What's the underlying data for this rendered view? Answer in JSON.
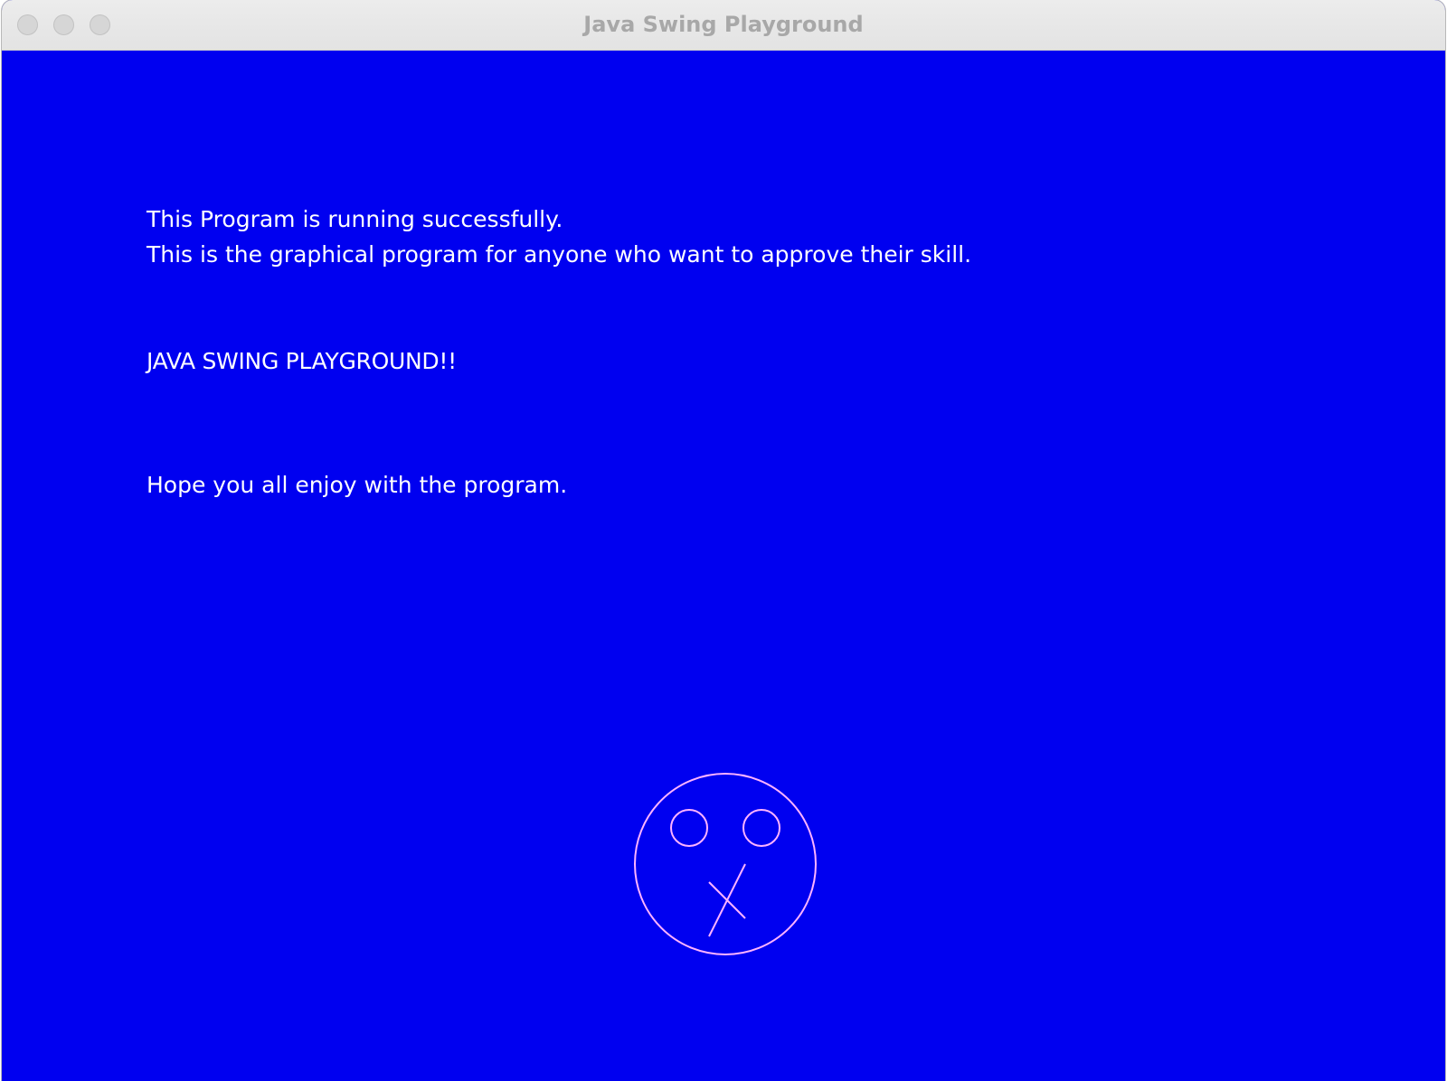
{
  "window": {
    "title": "Java Swing Playground",
    "controls": [
      "close-icon",
      "minimize-icon",
      "zoom-icon"
    ]
  },
  "canvas": {
    "background_color": "#0000f0",
    "text_color": "#ffffff",
    "face_color": "#ffb3ff",
    "lines": [
      "This Program is running successfully.",
      "This is the graphical program for anyone who want to approve their skill.",
      "JAVA SWING PLAYGROUND!!",
      "Hope you all enjoy with the program."
    ]
  }
}
